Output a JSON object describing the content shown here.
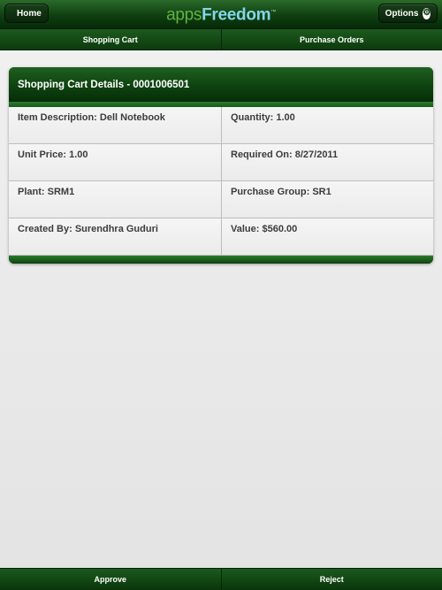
{
  "header": {
    "home_label": "Home",
    "home_icon": "home-icon",
    "logo_apps": "apps",
    "logo_freedom": "Freedom",
    "logo_tm": "™",
    "options_label": "Options",
    "options_icon": "gear-icon"
  },
  "tabs": [
    {
      "label": "Shopping Cart"
    },
    {
      "label": "Purchase Orders"
    }
  ],
  "panel": {
    "title": "Shopping Cart Details - 0001006501",
    "fields": [
      {
        "label": "Item Description:",
        "value": "Dell Notebook"
      },
      {
        "label": "Quantity:",
        "value": "1.00"
      },
      {
        "label": "Unit Price:",
        "value": "1.00"
      },
      {
        "label": "Required On:",
        "value": "8/27/2011"
      },
      {
        "label": "Plant:",
        "value": "SRM1"
      },
      {
        "label": "Purchase Group:",
        "value": "SR1"
      },
      {
        "label": "Created By:",
        "value": "Surendhra Guduri"
      },
      {
        "label": "Value:",
        "value": "$560.00"
      }
    ]
  },
  "footer": {
    "approve_label": "Approve",
    "reject_label": "Reject"
  },
  "colors": {
    "brand_green": "#0f3f10",
    "logo_apps": "#62b341",
    "logo_freedom": "#82d6e8"
  }
}
